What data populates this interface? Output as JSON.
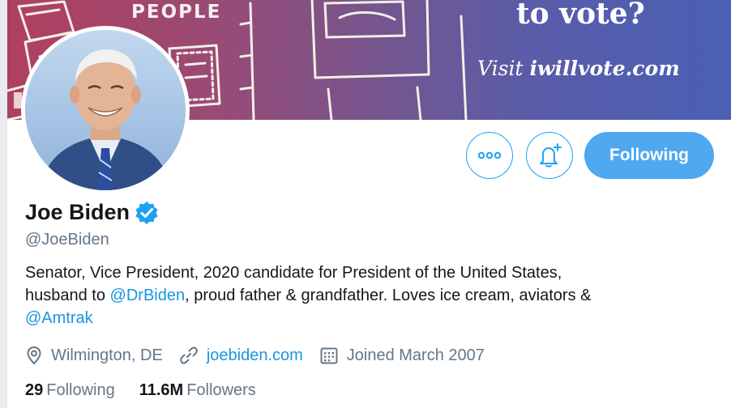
{
  "banner": {
    "people_text": "PEOPLE",
    "headline": "to vote?",
    "visit_prefix": "Visit ",
    "visit_url": "iwillvote.com"
  },
  "profile": {
    "display_name": "Joe Biden",
    "handle": "@JoeBiden",
    "verified_icon": "verified-badge-icon",
    "bio": {
      "line1": "Senator, Vice President, 2020 candidate for President of the United States,",
      "line2_prefix": "husband to ",
      "mention1": "@DrBiden",
      "line2_suffix": ", proud father & grandfather. Loves ice cream, aviators &",
      "mention2": "@Amtrak"
    },
    "location": "Wilmington, DE",
    "website": "joebiden.com",
    "joined": "Joined March 2007"
  },
  "actions": {
    "more_icon": "more-horizontal-icon",
    "notify_icon": "bell-plus-icon",
    "following_label": "Following"
  },
  "stats": {
    "following_count": "29",
    "following_label": "Following",
    "followers_count": "11.6M",
    "followers_label": "Followers"
  },
  "colors": {
    "accent": "#1da1f2",
    "link": "#1b95e0",
    "following_button": "#4fa8f0",
    "muted_text": "#657786",
    "banner_left": "#b0405f",
    "banner_right": "#4a5fb5"
  }
}
